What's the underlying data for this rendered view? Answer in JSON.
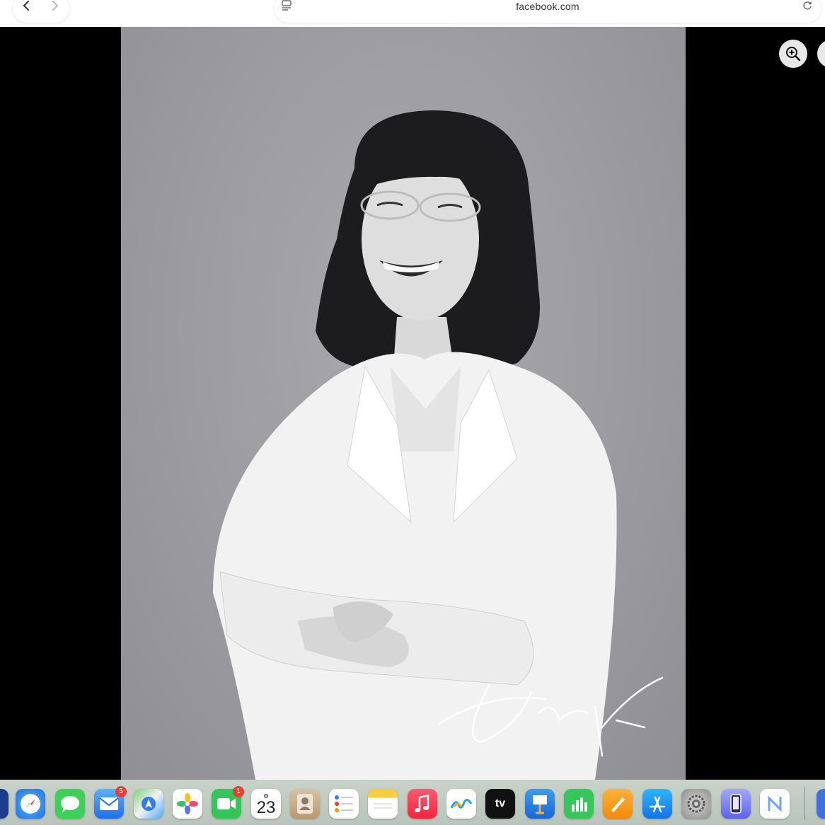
{
  "browser": {
    "url": "facebook.com"
  },
  "calendar_day": "23",
  "calendar_month": "❂",
  "dock": {
    "mail_badge": "5",
    "facetime_badge": "1",
    "tv_label": "tv"
  },
  "colors": {
    "photo_bg": "#9b9ba0",
    "viewer_bg": "#000000",
    "badge": "#f23b30"
  }
}
